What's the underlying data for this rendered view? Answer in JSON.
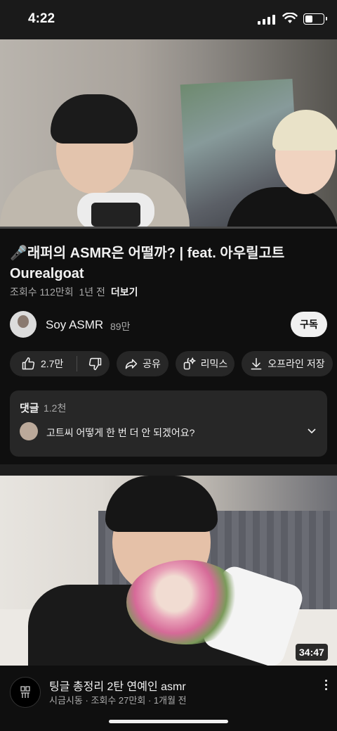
{
  "status_bar": {
    "time": "4:22"
  },
  "video": {
    "progress_fraction": 0.0,
    "title": "🎤래퍼의 ASMR은 어떨까? | feat. 아우릴고트 Ourealgoat",
    "views": "조회수 112만회",
    "age": "1년 전",
    "more_label": "더보기"
  },
  "channel": {
    "name": "Soy ASMR",
    "subscribers": "89만",
    "subscribe_label": "구독"
  },
  "actions": {
    "likes": "2.7만",
    "share_label": "공유",
    "remix_label": "리믹스",
    "download_label": "오프라인 저장"
  },
  "comments": {
    "title": "댓글",
    "count": "1.2천",
    "top_comment": "고트씨 어떻게 한 번 더 안 되겠어요?"
  },
  "next_video": {
    "duration": "34:47",
    "title": "팅글 총정리 2탄 연예인 asmr",
    "channel": "시금시동",
    "views": "조회수 27만회",
    "age": "1개월 전"
  },
  "colors": {
    "background": "#0f0f0f",
    "surface": "#272727",
    "text_primary": "#f1f1f1",
    "text_secondary": "#aaaaaa",
    "progress": "#ff0000"
  }
}
